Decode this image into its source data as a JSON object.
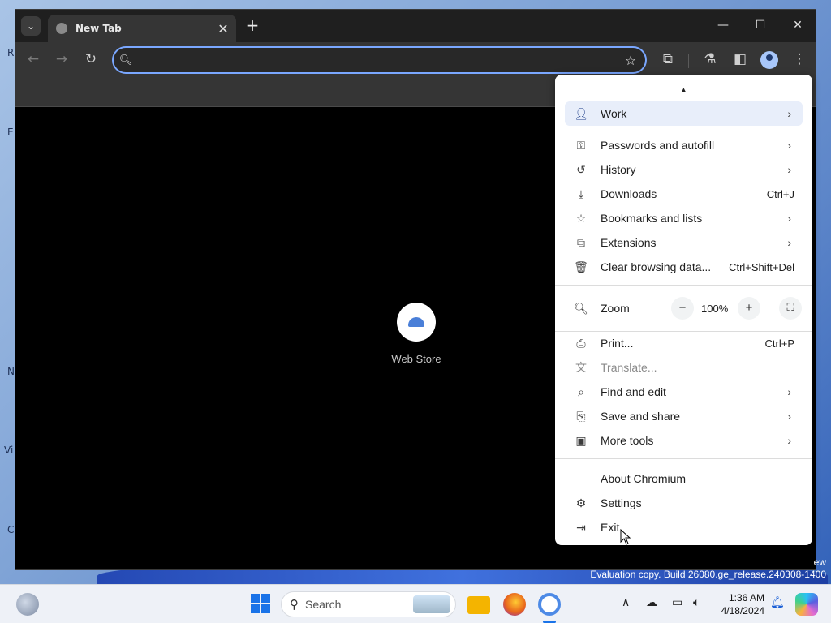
{
  "desktop": {
    "edge_letters": [
      "R",
      "E",
      "N",
      "Vi",
      "C"
    ],
    "watermark_line1": "ew",
    "watermark_line2": "Evaluation copy. Build 26080.ge_release.240308-1400"
  },
  "browser": {
    "tab_title": "New Tab",
    "omnibox": {
      "value": "",
      "placeholder": ""
    },
    "shortcut_label": "Web Store"
  },
  "menu": {
    "profile_label": "Work",
    "items_group1": [
      {
        "label": "Passwords and autofill",
        "icon": "key-icon",
        "shortcut": "",
        "submenu": true
      },
      {
        "label": "History",
        "icon": "history-icon",
        "shortcut": "",
        "submenu": true
      },
      {
        "label": "Downloads",
        "icon": "download-icon",
        "shortcut": "Ctrl+J",
        "submenu": false
      },
      {
        "label": "Bookmarks and lists",
        "icon": "star-icon",
        "shortcut": "",
        "submenu": true
      },
      {
        "label": "Extensions",
        "icon": "puzzle-icon",
        "shortcut": "",
        "submenu": true
      },
      {
        "label": "Clear browsing data...",
        "icon": "trash-icon",
        "shortcut": "Ctrl+Shift+Del",
        "submenu": false
      }
    ],
    "zoom": {
      "label": "Zoom",
      "value": "100%",
      "minus": "−",
      "plus": "+"
    },
    "items_group2": [
      {
        "label": "Print...",
        "icon": "printer-icon",
        "shortcut": "Ctrl+P",
        "submenu": false,
        "disabled": false
      },
      {
        "label": "Translate...",
        "icon": "translate-icon",
        "shortcut": "",
        "submenu": false,
        "disabled": true
      },
      {
        "label": "Find and edit",
        "icon": "find-icon",
        "shortcut": "",
        "submenu": true,
        "disabled": false
      },
      {
        "label": "Save and share",
        "icon": "save-share-icon",
        "shortcut": "",
        "submenu": true,
        "disabled": false
      },
      {
        "label": "More tools",
        "icon": "toolbox-icon",
        "shortcut": "",
        "submenu": true,
        "disabled": false
      }
    ],
    "items_group3": [
      {
        "label": "About Chromium",
        "icon": ""
      },
      {
        "label": "Settings",
        "icon": "gear-icon"
      },
      {
        "label": "Exit",
        "icon": "exit-icon"
      }
    ]
  },
  "taskbar": {
    "search_label": "Search",
    "time": "1:36 AM",
    "date": "4/18/2024"
  }
}
